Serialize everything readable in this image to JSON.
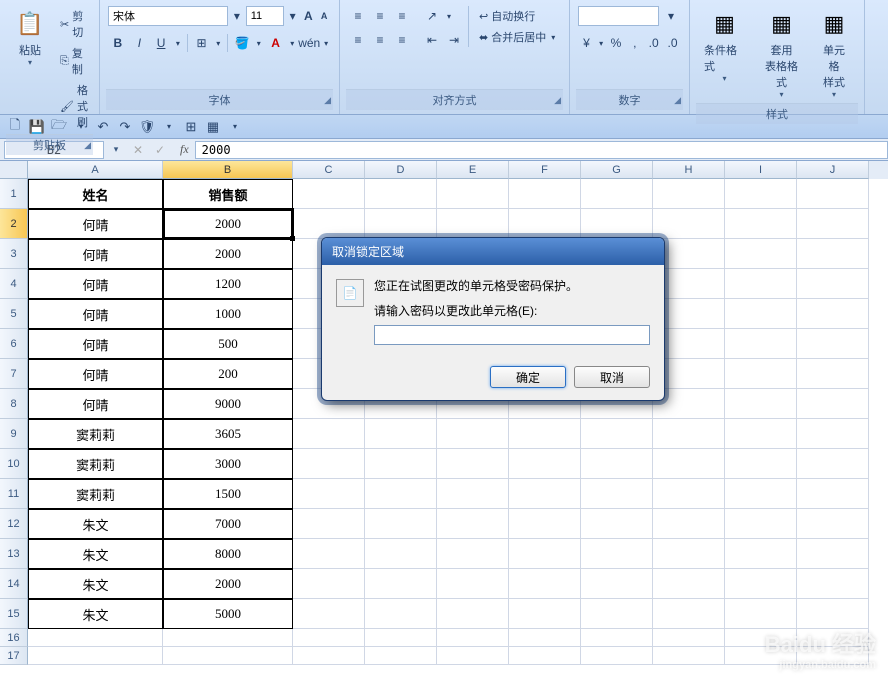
{
  "ribbon": {
    "clipboard": {
      "paste": "粘贴",
      "cut": "剪切",
      "copy": "复制",
      "format_painter": "格式刷",
      "group_label": "剪贴板"
    },
    "font": {
      "name": "宋体",
      "size": "11",
      "group_label": "字体"
    },
    "alignment": {
      "wrap": "自动换行",
      "merge": "合并后居中",
      "group_label": "对齐方式"
    },
    "number": {
      "group_label": "数字"
    },
    "styles": {
      "cond_fmt": "条件格式",
      "table_fmt": "套用\n表格格式",
      "cell_styles": "单元格\n样式",
      "group_label": "样式"
    }
  },
  "name_box": "B2",
  "formula_value": "2000",
  "columns": [
    "A",
    "B",
    "C",
    "D",
    "E",
    "F",
    "G",
    "H",
    "I",
    "J"
  ],
  "col_widths": {
    "A": 135,
    "B": 130,
    "default": 72
  },
  "active_col": "B",
  "active_row": 2,
  "rows": [
    1,
    2,
    3,
    4,
    5,
    6,
    7,
    8,
    9,
    10,
    11,
    12,
    13,
    14,
    15,
    16,
    17
  ],
  "table": {
    "headers": {
      "a": "姓名",
      "b": "销售额"
    },
    "data": [
      {
        "a": "何晴",
        "b": "2000"
      },
      {
        "a": "何晴",
        "b": "2000"
      },
      {
        "a": "何晴",
        "b": "1200"
      },
      {
        "a": "何晴",
        "b": "1000"
      },
      {
        "a": "何晴",
        "b": "500"
      },
      {
        "a": "何晴",
        "b": "200"
      },
      {
        "a": "何晴",
        "b": "9000"
      },
      {
        "a": "窦莉莉",
        "b": "3605"
      },
      {
        "a": "窦莉莉",
        "b": "3000"
      },
      {
        "a": "窦莉莉",
        "b": "1500"
      },
      {
        "a": "朱文",
        "b": "7000"
      },
      {
        "a": "朱文",
        "b": "8000"
      },
      {
        "a": "朱文",
        "b": "2000"
      },
      {
        "a": "朱文",
        "b": "5000"
      }
    ]
  },
  "dialog": {
    "title": "取消锁定区域",
    "line1": "您正在试图更改的单元格受密码保护。",
    "line2": "请输入密码以更改此单元格(E):",
    "ok": "确定",
    "cancel": "取消"
  },
  "watermark": {
    "main": "Baidu 经验",
    "sub": "jingyan.baidu.com"
  }
}
